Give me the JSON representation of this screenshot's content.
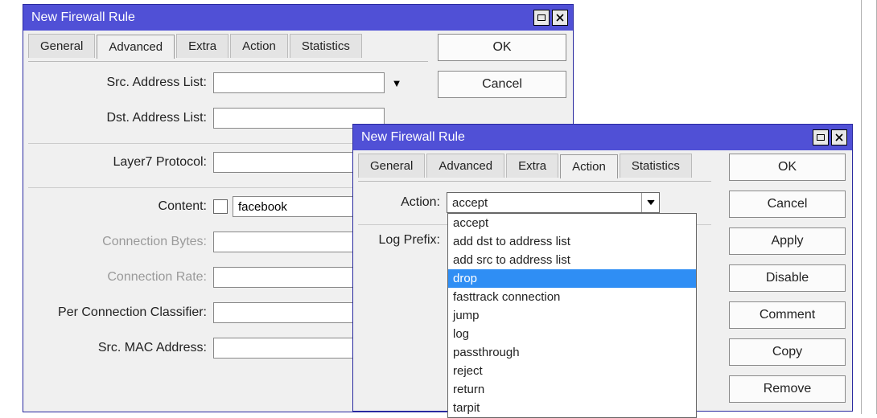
{
  "w1": {
    "title": "New Firewall Rule",
    "tabs": [
      "General",
      "Advanced",
      "Extra",
      "Action",
      "Statistics"
    ],
    "active_tab": 1,
    "buttons": {
      "ok": "OK",
      "cancel": "Cancel"
    },
    "fields": {
      "src_addr_list": {
        "label": "Src. Address List:",
        "value": ""
      },
      "dst_addr_list": {
        "label": "Dst. Address List:",
        "value": ""
      },
      "layer7": {
        "label": "Layer7 Protocol:",
        "value": ""
      },
      "content": {
        "label": "Content:",
        "value": "facebook"
      },
      "conn_bytes": {
        "label": "Connection Bytes:",
        "value": ""
      },
      "conn_rate": {
        "label": "Connection Rate:",
        "value": ""
      },
      "per_conn_class": {
        "label": "Per Connection Classifier:",
        "value": ""
      },
      "src_mac": {
        "label": "Src. MAC Address:",
        "value": ""
      }
    }
  },
  "w2": {
    "title": "New Firewall Rule",
    "tabs": [
      "General",
      "Advanced",
      "Extra",
      "Action",
      "Statistics"
    ],
    "active_tab": 3,
    "buttons": {
      "ok": "OK",
      "cancel": "Cancel",
      "apply": "Apply",
      "disable": "Disable",
      "comment": "Comment",
      "copy": "Copy",
      "remove": "Remove"
    },
    "fields": {
      "action": {
        "label": "Action:",
        "value": "accept"
      },
      "log_prefix": {
        "label": "Log Prefix:",
        "value": ""
      }
    },
    "action_options": [
      "accept",
      "add dst to address list",
      "add src to address list",
      "drop",
      "fasttrack connection",
      "jump",
      "log",
      "passthrough",
      "reject",
      "return",
      "tarpit"
    ],
    "action_highlight_index": 3
  }
}
